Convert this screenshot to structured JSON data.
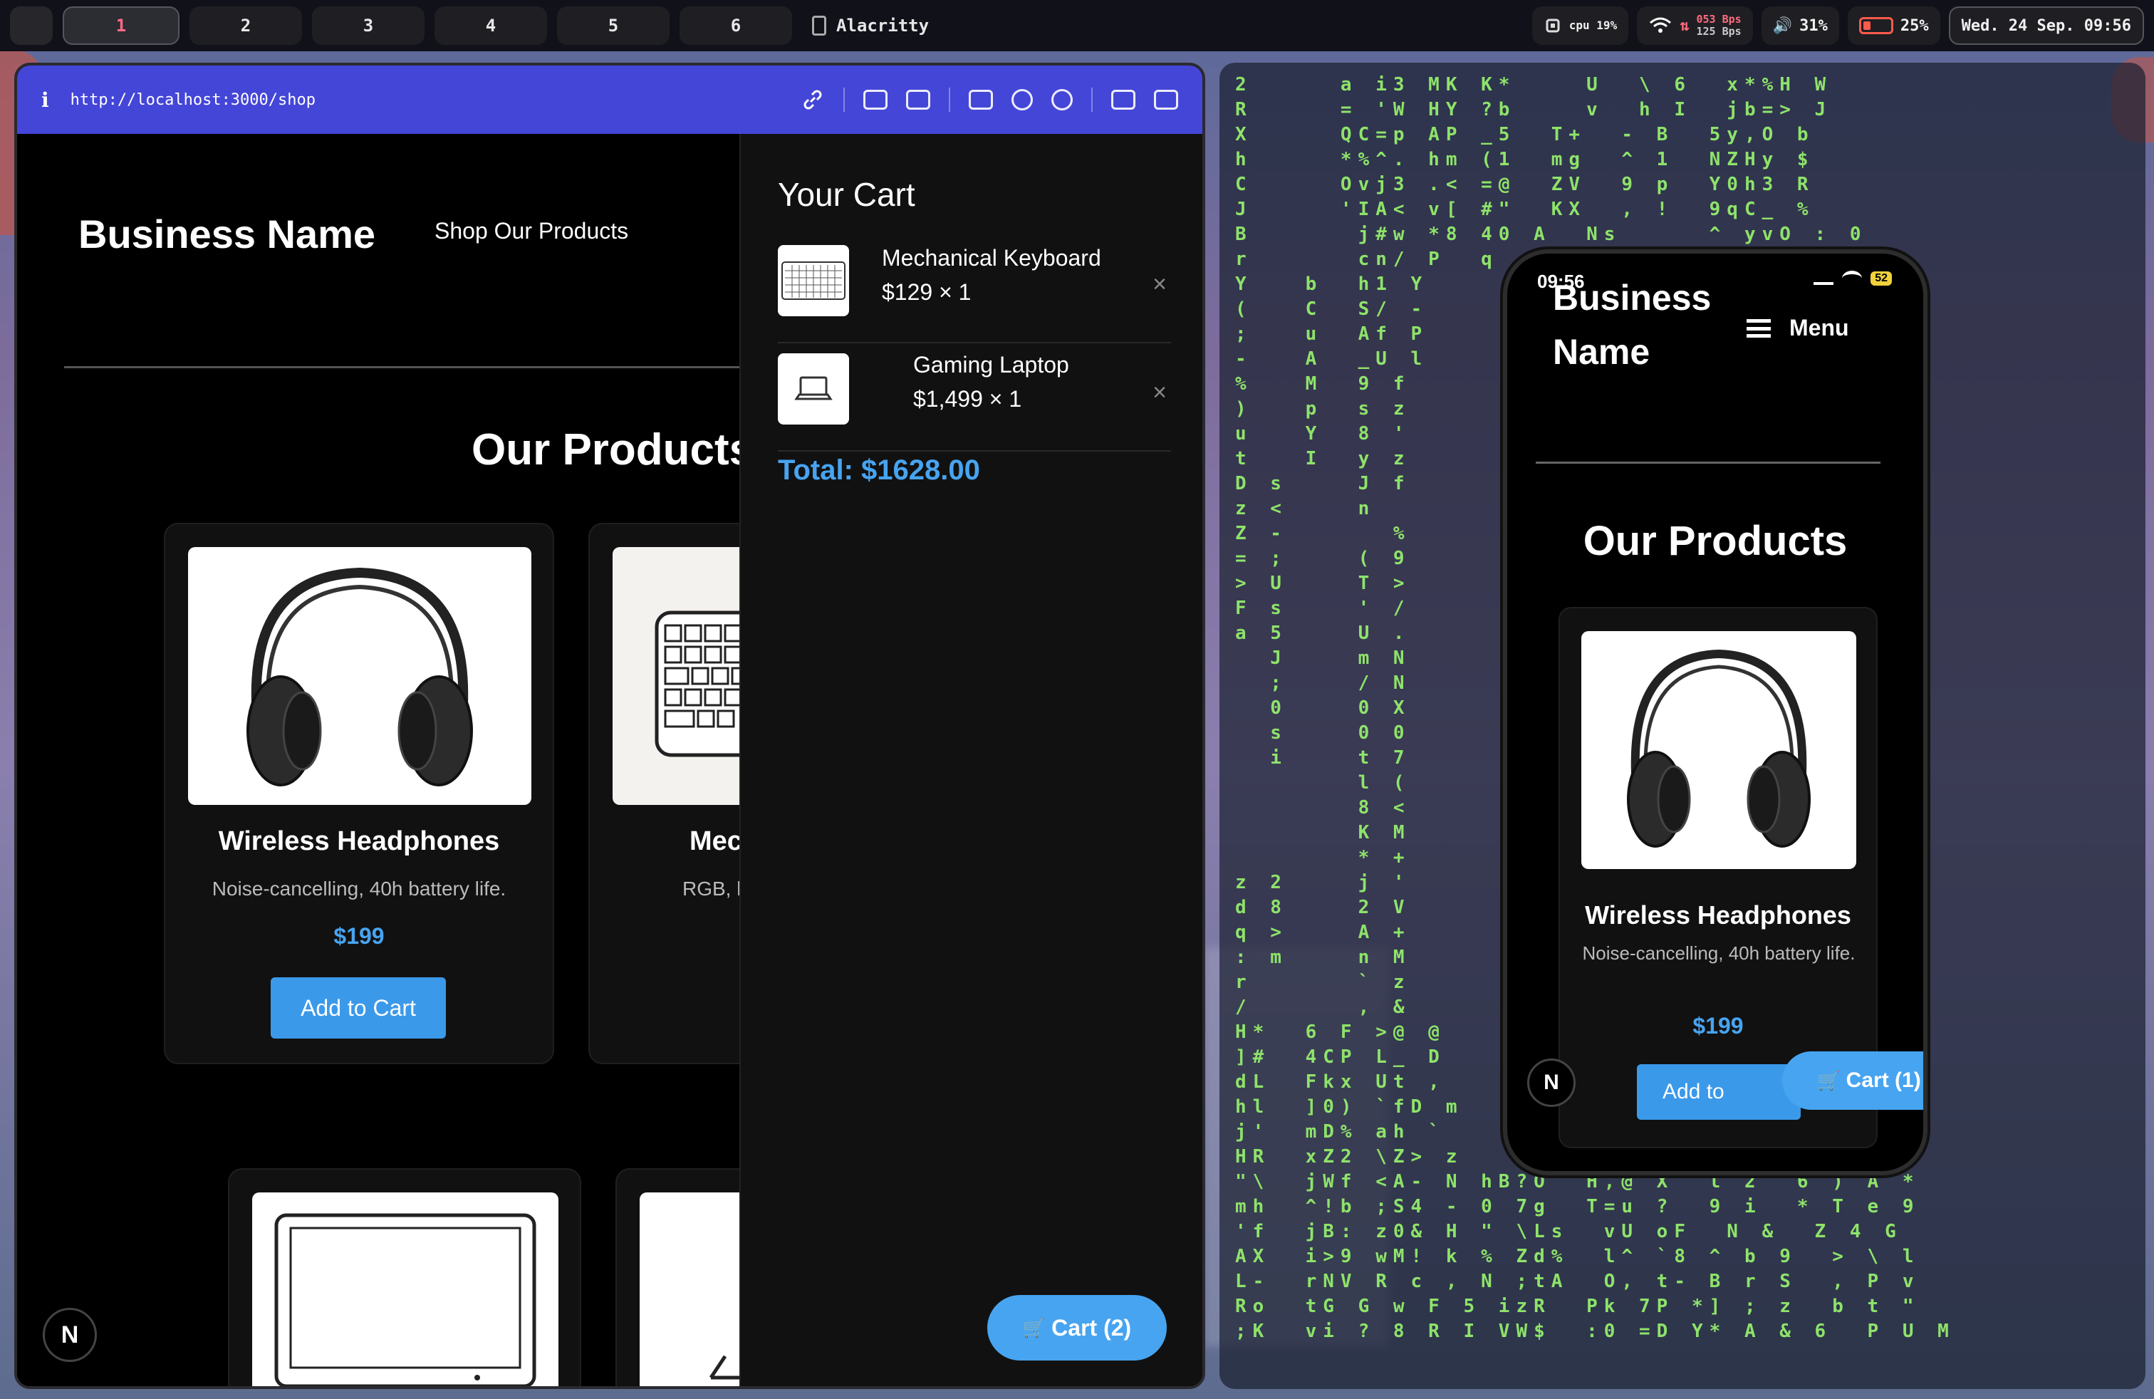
{
  "topbar": {
    "apple": "",
    "workspaces": [
      "1",
      "2",
      "3",
      "4",
      "5",
      "6"
    ],
    "active_workspace": "1",
    "app_name": "Alacritty",
    "cpu_label": "cpu 19%",
    "net_up": "053 Bps",
    "net_down": "125 Bps",
    "volume": "31%",
    "battery": "25%",
    "datetime": "Wed. 24 Sep. 09:56"
  },
  "browser": {
    "info_icon": "i",
    "url": "http://localhost:3000/shop",
    "icons": [
      "link-icon",
      "download-image-icon",
      "camera-icon",
      "terminal-icon",
      "globe-icon",
      "crosshair-icon",
      "extension-icon",
      "split-view-icon"
    ],
    "site_title": "Business Name",
    "nav_link": "Shop Our Products",
    "section_title": "Our Products",
    "products": [
      {
        "name": "Wireless Headphones",
        "desc": "Noise-cancelling, 40h battery life.",
        "price": "$199",
        "button": "Add to Cart"
      },
      {
        "name": "Mec",
        "desc": "RGB, h",
        "price": "",
        "button": ""
      }
    ],
    "n_badge": "N",
    "cart": {
      "title": "Your Cart",
      "items": [
        {
          "name": "Mechanical Keyboard",
          "qty": "$129 × 1"
        },
        {
          "name": "Gaming Laptop",
          "qty": "$1,499 × 1"
        }
      ],
      "remove": "×",
      "total": "Total: $1628.00",
      "fab": "Cart (2)",
      "fab_icon": "🛒"
    }
  },
  "phone": {
    "time": "09:56",
    "battery": "52",
    "title_partial": "Business",
    "title": "Name",
    "menu": "Menu",
    "section_title": "Our Products",
    "product_name": "Wireless Headphones",
    "product_desc": "Noise-cancelling, 40h battery life.",
    "price": "$199",
    "add_button": "Add to",
    "fab": "Cart (1)",
    "fab_icon": "🛒",
    "n_badge": "N"
  },
  "matrix_text": "2     a i3 MK K*    U  \\ 6  x*%H W\nR     = 'W HY ?b    v  h I  jb=> J\nX     QC=p AP _5  T+  - B  5y,O b\nh     *%^. hm (1  mg  ^ 1  NZHy $\nC     Ovj3 .< =@  ZV  9 p  Y0h3 R\nJ     'IA< v[ #\"  KX  , !  9qC_ %\nB      j#w *8 40 A  Ns     ^ yvO : 0\nr      cn/ P  q  v         v  9 0 o\nY   b  h1 Y               d\n(   C  S/ -             x\n;   u  Af P             F\n-   A  _U l           u \\\n%   M  9 f           M l\n)   p  s z           ' 3\nu   Y  8 '           l Z\nt   I  y z           - <\nD s    J f           s I  S\nz <    n             W -  `\nZ -      %           o /  1\n= ;    ( 9           D i  L\n> U    T >           C N  6\nF s    ' /           G P  4\na 5    U .           f t  d\n  J    m N           z R  G\n  ;    / N           I X  L\n  0    0 X           D a  p\n  s    0 0           j M  j\n  i    t 7           : K  u\n       l (           o ?  8\n       8 <           )    f\n       K M           $    _\n       * +           ] ' ? S\nz 2    j '          ^ B x ' $\nd 8    2 V          R . B U h\nq >    A +          r Z ' < F\n: m    n M          O u D D B\nr      ` z          = ? _ - 5\n/      , &         2 : 4 V 0\nH*  6 F >@ @        t ( w o : Y R\n]#  4CP L_ D        ` l   5 w 6 7\ndL  Fkx Ut ,        A m   , h l @\nhl  ]0) `fD m       ? 4   p W o ?\nj'  mD% ah `        \" #   j h Q J\nHR  xZ2 \\Z> z       e +   A w O Q\n\"\\  jWf <A- N hB?O  H,@ X  l 2  6 ) A *\nmh  ^!b ;S4 - 0 7g  T=u ?  9 i  * T e 9\n'f  jB: z0& H \" \\Ls  vU oF  N &  Z 4 G\nAX  i>9 wM! k % Zd%  l^ `8 ^ b 9  > \\ l\nL-  rNV R c , N ;tA  O, t- B r S  , P v\nRo  tG G w F 5 izR  Pk 7P *] ; z  b t \"\n;K  vi ? 8 R I VW$  :0 =D Y* A & 6  P U M"
}
